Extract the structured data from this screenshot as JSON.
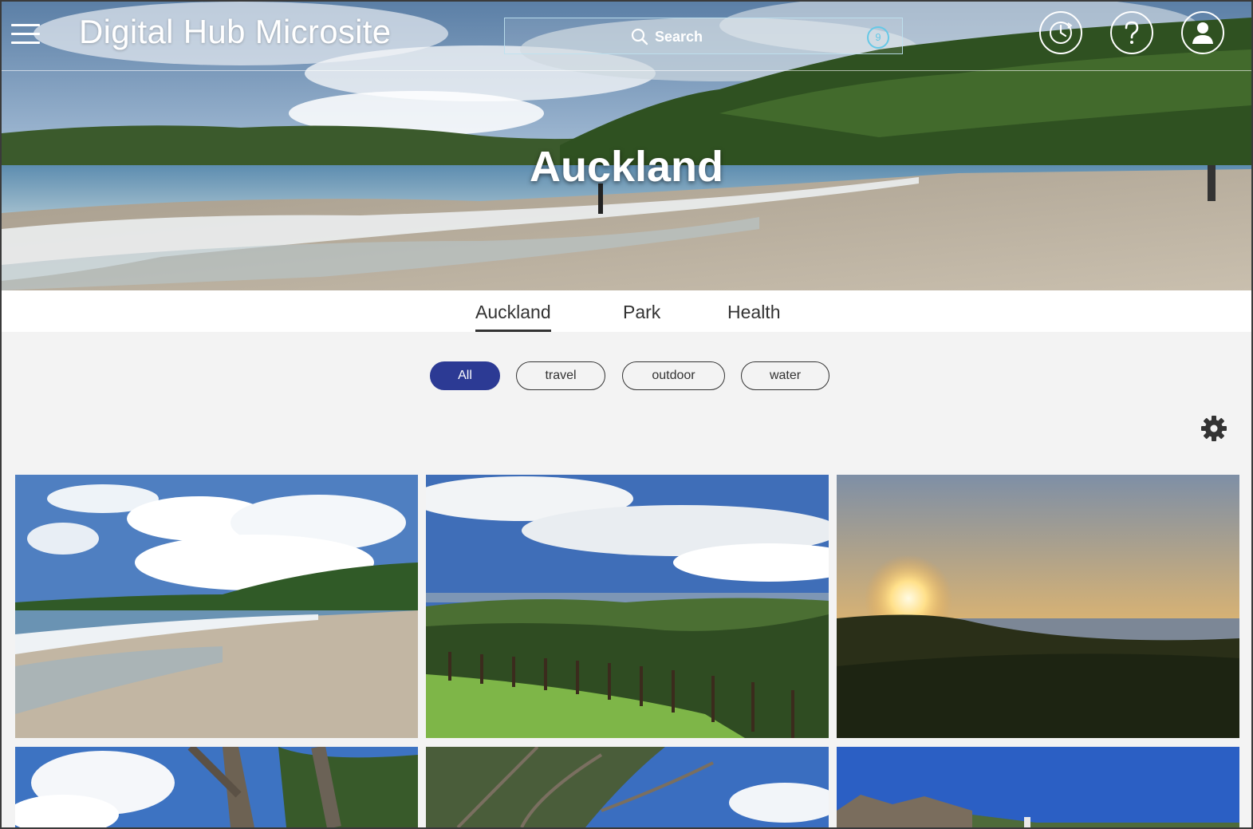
{
  "header": {
    "menu_icon": "hamburger-menu-icon",
    "site_title": "Digital Hub Microsite",
    "search": {
      "label": "Search",
      "badge": "9"
    },
    "icons": [
      "history-clock-icon",
      "help-question-icon",
      "user-profile-icon"
    ]
  },
  "hero": {
    "title": "Auckland"
  },
  "tabs": [
    {
      "label": "Auckland",
      "active": true
    },
    {
      "label": "Park",
      "active": false
    },
    {
      "label": "Health",
      "active": false
    }
  ],
  "filters": [
    {
      "label": "All",
      "active": true
    },
    {
      "label": "travel",
      "active": false
    },
    {
      "label": "outdoor",
      "active": false
    },
    {
      "label": "water",
      "active": false
    }
  ],
  "settings_icon": "gear-icon",
  "colors": {
    "accent": "#2c3a94",
    "badge": "#66c8e6"
  },
  "gallery_images": [
    "beach-photo",
    "vineyard-photo",
    "sunset-photo",
    "tree-photo",
    "tree-branches-photo",
    "house-photo"
  ]
}
